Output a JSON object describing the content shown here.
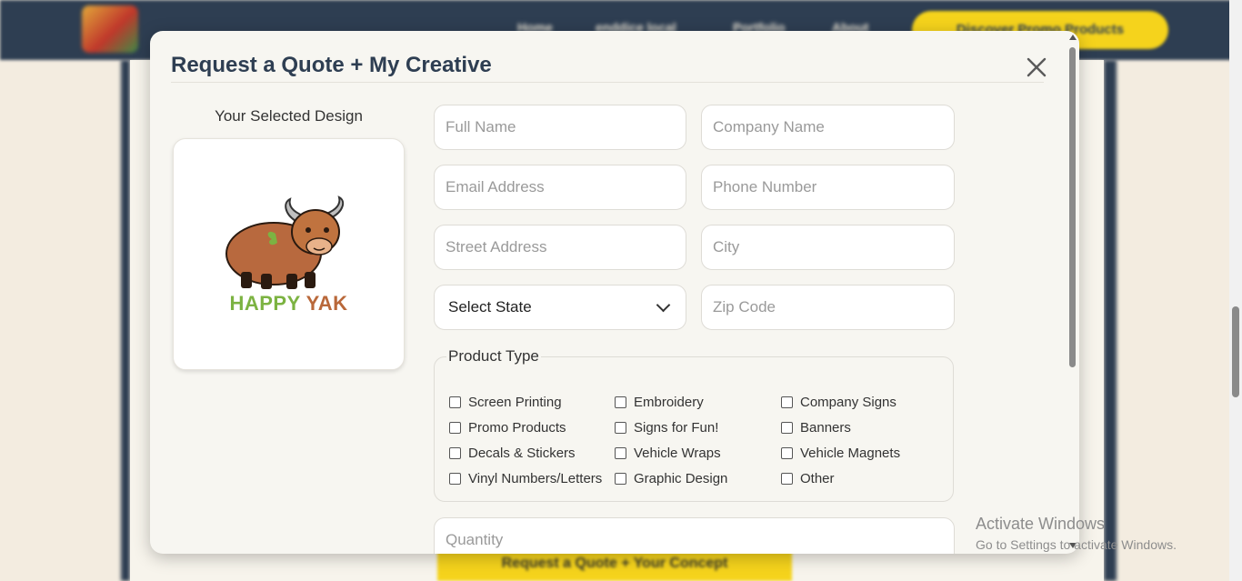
{
  "background": {
    "nav_items": [
      "Home",
      "enddice local",
      "Portfolio",
      "About"
    ],
    "cta_label": "Discover Promo Products",
    "bottom_button": "Request a Quote + Your Concept"
  },
  "modal": {
    "title": "Request a Quote + My Creative",
    "close_icon": "close-icon",
    "design_label": "Your Selected Design",
    "logo_text_1": "HAPPY",
    "logo_text_2": "YAK",
    "fields": {
      "full_name": "Full Name",
      "company_name": "Company Name",
      "email": "Email Address",
      "phone": "Phone Number",
      "street": "Street Address",
      "city": "City",
      "zip": "Zip Code",
      "quantity": "Quantity"
    },
    "state_select": {
      "selected": "Select State"
    },
    "product_type": {
      "legend": "Product Type",
      "options": [
        "Screen Printing",
        "Embroidery",
        "Company Signs",
        "Promo Products",
        "Signs for Fun!",
        "Banners",
        "Decals & Stickers",
        "Vehicle Wraps",
        "Vehicle Magnets",
        "Vinyl Numbers/Letters",
        "Graphic Design",
        "Other"
      ]
    }
  },
  "watermark": {
    "line1": "Activate Windows",
    "line2": "Go to Settings to activate Windows."
  },
  "colors": {
    "navy": "#2e3e52",
    "yellow": "#f5d31c",
    "modal_bg": "#f7f6f1"
  }
}
